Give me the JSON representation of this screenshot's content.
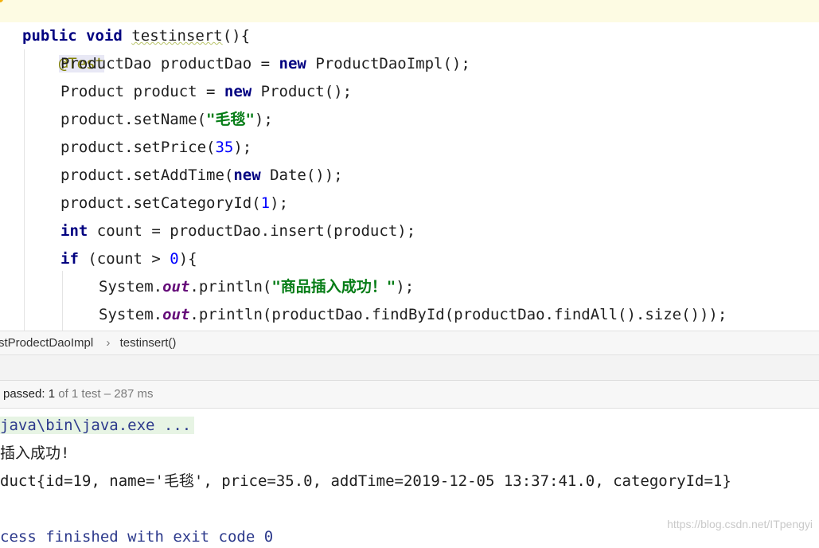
{
  "editor": {
    "lines": {
      "l1": {
        "anno": "@Test"
      },
      "l2": {
        "k1": "public",
        "k2": "void",
        "name": "testinsert",
        "rest": "(){"
      },
      "l3": {
        "a": "ProductDao productDao = ",
        "kw": "new",
        "b": " ProductDaoImpl();"
      },
      "l4": {
        "a": "Product product = ",
        "kw": "new",
        "b": " Product();"
      },
      "l5": {
        "a": "product.setName(",
        "s": "\"毛毯\"",
        "b": ");"
      },
      "l6": {
        "a": "product.setPrice(",
        "n": "35",
        "b": ");"
      },
      "l7": {
        "a": "product.setAddTime(",
        "kw": "new",
        "b": " Date());"
      },
      "l8": {
        "a": "product.setCategoryId(",
        "n": "1",
        "b": ");"
      },
      "l9": {
        "kw": "int",
        "b": " count = productDao.insert(product);"
      },
      "l10": {
        "kw": "if",
        "a": " (count > ",
        "n": "0",
        "b": "){"
      },
      "l11": {
        "a": "System.",
        "f": "out",
        "b": ".println(",
        "s": "\"商品插入成功！\"",
        "c": ");"
      },
      "l12": {
        "a": "System.",
        "f": "out",
        "b": ".println(productDao.findById(productDao.findAll().size()));"
      }
    }
  },
  "breadcrumb": {
    "cls": "stProdectDaoImpl",
    "sep": "›",
    "method": "testinsert()"
  },
  "status": {
    "passed_label": "passed:",
    "passed_count": "1",
    "rest": "of 1 test – 287 ms"
  },
  "console": {
    "cmd": "java\\bin\\java.exe ...",
    "line1": "插入成功!",
    "line2": "duct{id=19, name='毛毯', price=35.0, addTime=2019-12-05 13:37:41.0, categoryId=1}",
    "line3": "cess finished with exit code 0"
  },
  "watermark": "https://blog.csdn.net/ITpengyi",
  "colors": {
    "keyword": "#000080",
    "number": "#0000ff",
    "string": "#067d17",
    "static_field": "#660e7a",
    "annotation": "#808000",
    "console_blue": "#2d3a8c",
    "current_line": "#fdfbe3"
  }
}
